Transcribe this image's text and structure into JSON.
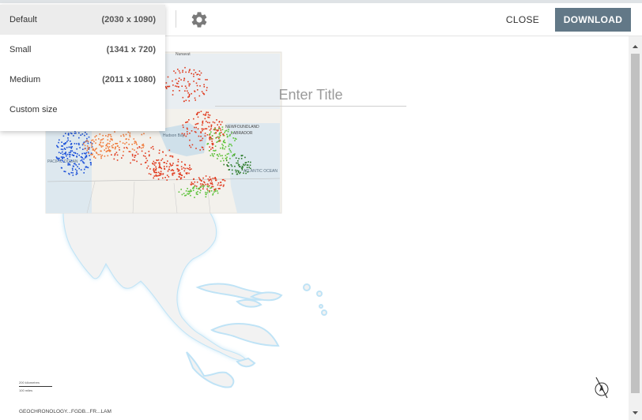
{
  "toolbar": {
    "settings_icon": "gear-icon",
    "close_label": "CLOSE",
    "download_label": "DOWNLOAD",
    "download_color": "#627887"
  },
  "size_menu": {
    "items": [
      {
        "label": "Default",
        "dims": "(2030 x 1090)",
        "selected": true
      },
      {
        "label": "Small",
        "dims": "(1341 x 720)",
        "selected": false
      },
      {
        "label": "Medium",
        "dims": "(2011 x 1080)",
        "selected": false
      },
      {
        "label": "Custom size",
        "dims": "",
        "selected": false
      }
    ]
  },
  "map": {
    "title_placeholder": "Enter Title",
    "labels": {
      "hudson_bay": "Hudson Bay",
      "newfoundland": "NEWFOUNDLAND",
      "labrador": "LABRADOR",
      "atlantic_ocean": "ATLANTIC OCEAN",
      "pacific_ocean": "PACIFIC OCEAN",
      "nunavut": "Nunavut"
    },
    "scale_text_1": "200 kilometres",
    "scale_text_2": "100 miles",
    "attribution": "GEOCHRONOLOGY...FGDB...FR...LAM",
    "north_arrow_icon": "north-arrow-icon",
    "point_colors": [
      "#1a4fd8",
      "#e03a1e",
      "#f07a3a",
      "#5cc23a",
      "#2c7a2a"
    ],
    "land_color": "#f2f2f2",
    "coast_glow_color": "#bfe3f6"
  },
  "scrollbar": {
    "up_icon": "scroll-up-arrow-icon",
    "down_icon": "scroll-down-arrow-icon"
  }
}
